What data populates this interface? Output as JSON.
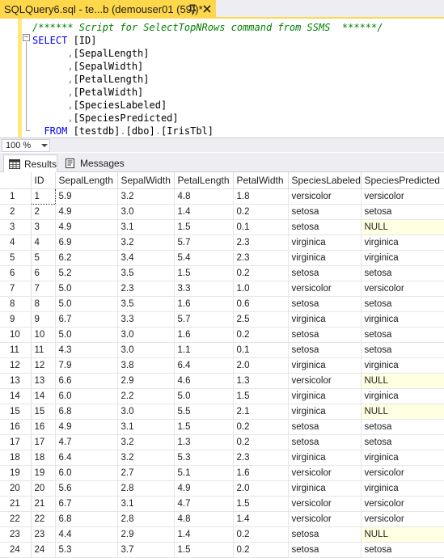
{
  "tab": {
    "title": "SQLQuery6.sql - te...b (demouser01 (59))*"
  },
  "editor": {
    "lines": [
      {
        "parts": [
          {
            "cls": "cm",
            "text": "/****** Script for SelectTopNRows command from SSMS  ******/"
          }
        ]
      },
      {
        "parts": [
          {
            "cls": "kw",
            "text": "SELECT "
          },
          {
            "cls": "tx",
            "text": "[ID]"
          }
        ]
      },
      {
        "parts": [
          {
            "cls": "gr",
            "text": "      ,"
          },
          {
            "cls": "tx",
            "text": "[SepalLength]"
          }
        ]
      },
      {
        "parts": [
          {
            "cls": "gr",
            "text": "      ,"
          },
          {
            "cls": "tx",
            "text": "[SepalWidth]"
          }
        ]
      },
      {
        "parts": [
          {
            "cls": "gr",
            "text": "      ,"
          },
          {
            "cls": "tx",
            "text": "[PetalLength]"
          }
        ]
      },
      {
        "parts": [
          {
            "cls": "gr",
            "text": "      ,"
          },
          {
            "cls": "tx",
            "text": "[PetalWidth]"
          }
        ]
      },
      {
        "parts": [
          {
            "cls": "gr",
            "text": "      ,"
          },
          {
            "cls": "tx",
            "text": "[SpeciesLabeled]"
          }
        ]
      },
      {
        "parts": [
          {
            "cls": "gr",
            "text": "      ,"
          },
          {
            "cls": "tx",
            "text": "[SpeciesPredicted]"
          }
        ]
      },
      {
        "parts": [
          {
            "cls": "kw",
            "text": "  FROM "
          },
          {
            "cls": "tx",
            "text": "[testdb]"
          },
          {
            "cls": "gr",
            "text": "."
          },
          {
            "cls": "tx",
            "text": "[dbo]"
          },
          {
            "cls": "gr",
            "text": "."
          },
          {
            "cls": "tx",
            "text": "[IrisTbl]"
          }
        ]
      }
    ]
  },
  "zoom": {
    "value": "100 %"
  },
  "result_tabs": {
    "results_label": "Results",
    "messages_label": "Messages"
  },
  "grid": {
    "columns": [
      "",
      "ID",
      "SepalLength",
      "SepalWidth",
      "PetalLength",
      "PetalWidth",
      "SpeciesLabeled",
      "SpeciesPredicted"
    ],
    "rows": [
      [
        "1",
        "1",
        "5.9",
        "3.2",
        "4.8",
        "1.8",
        "versicolor",
        "versicolor"
      ],
      [
        "2",
        "2",
        "4.9",
        "3.0",
        "1.4",
        "0.2",
        "setosa",
        "setosa"
      ],
      [
        "3",
        "3",
        "4.9",
        "3.1",
        "1.5",
        "0.1",
        "setosa",
        "NULL"
      ],
      [
        "4",
        "4",
        "6.9",
        "3.2",
        "5.7",
        "2.3",
        "virginica",
        "virginica"
      ],
      [
        "5",
        "5",
        "6.2",
        "3.4",
        "5.4",
        "2.3",
        "virginica",
        "virginica"
      ],
      [
        "6",
        "6",
        "5.2",
        "3.5",
        "1.5",
        "0.2",
        "setosa",
        "setosa"
      ],
      [
        "7",
        "7",
        "5.0",
        "2.3",
        "3.3",
        "1.0",
        "versicolor",
        "versicolor"
      ],
      [
        "8",
        "8",
        "5.0",
        "3.5",
        "1.6",
        "0.6",
        "setosa",
        "setosa"
      ],
      [
        "9",
        "9",
        "6.7",
        "3.3",
        "5.7",
        "2.5",
        "virginica",
        "virginica"
      ],
      [
        "10",
        "10",
        "5.0",
        "3.0",
        "1.6",
        "0.2",
        "setosa",
        "setosa"
      ],
      [
        "11",
        "11",
        "4.3",
        "3.0",
        "1.1",
        "0.1",
        "setosa",
        "setosa"
      ],
      [
        "12",
        "12",
        "7.9",
        "3.8",
        "6.4",
        "2.0",
        "virginica",
        "virginica"
      ],
      [
        "13",
        "13",
        "6.6",
        "2.9",
        "4.6",
        "1.3",
        "versicolor",
        "NULL"
      ],
      [
        "14",
        "14",
        "6.0",
        "2.2",
        "5.0",
        "1.5",
        "virginica",
        "virginica"
      ],
      [
        "15",
        "15",
        "6.8",
        "3.0",
        "5.5",
        "2.1",
        "virginica",
        "NULL"
      ],
      [
        "16",
        "16",
        "4.9",
        "3.1",
        "1.5",
        "0.2",
        "setosa",
        "setosa"
      ],
      [
        "17",
        "17",
        "4.7",
        "3.2",
        "1.3",
        "0.2",
        "setosa",
        "setosa"
      ],
      [
        "18",
        "18",
        "6.4",
        "3.2",
        "5.3",
        "2.3",
        "virginica",
        "virginica"
      ],
      [
        "19",
        "19",
        "6.0",
        "2.7",
        "5.1",
        "1.6",
        "versicolor",
        "versicolor"
      ],
      [
        "20",
        "20",
        "5.6",
        "2.8",
        "4.9",
        "2.0",
        "virginica",
        "virginica"
      ],
      [
        "21",
        "21",
        "6.7",
        "3.1",
        "4.7",
        "1.5",
        "versicolor",
        "versicolor"
      ],
      [
        "22",
        "22",
        "6.8",
        "2.8",
        "4.8",
        "1.4",
        "versicolor",
        "versicolor"
      ],
      [
        "23",
        "23",
        "4.4",
        "2.9",
        "1.4",
        "0.2",
        "setosa",
        "NULL"
      ],
      [
        "24",
        "24",
        "5.3",
        "3.7",
        "1.5",
        "0.2",
        "setosa",
        "setosa"
      ]
    ]
  },
  "colors": {
    "tab_accent": "#ffd74a",
    "null_highlight": "#ffffe1",
    "keyword": "#0000ff",
    "comment": "#008000"
  },
  "icons": {
    "pin": "pin-icon",
    "close": "close-icon",
    "results": "grid-icon",
    "messages": "messages-icon"
  }
}
